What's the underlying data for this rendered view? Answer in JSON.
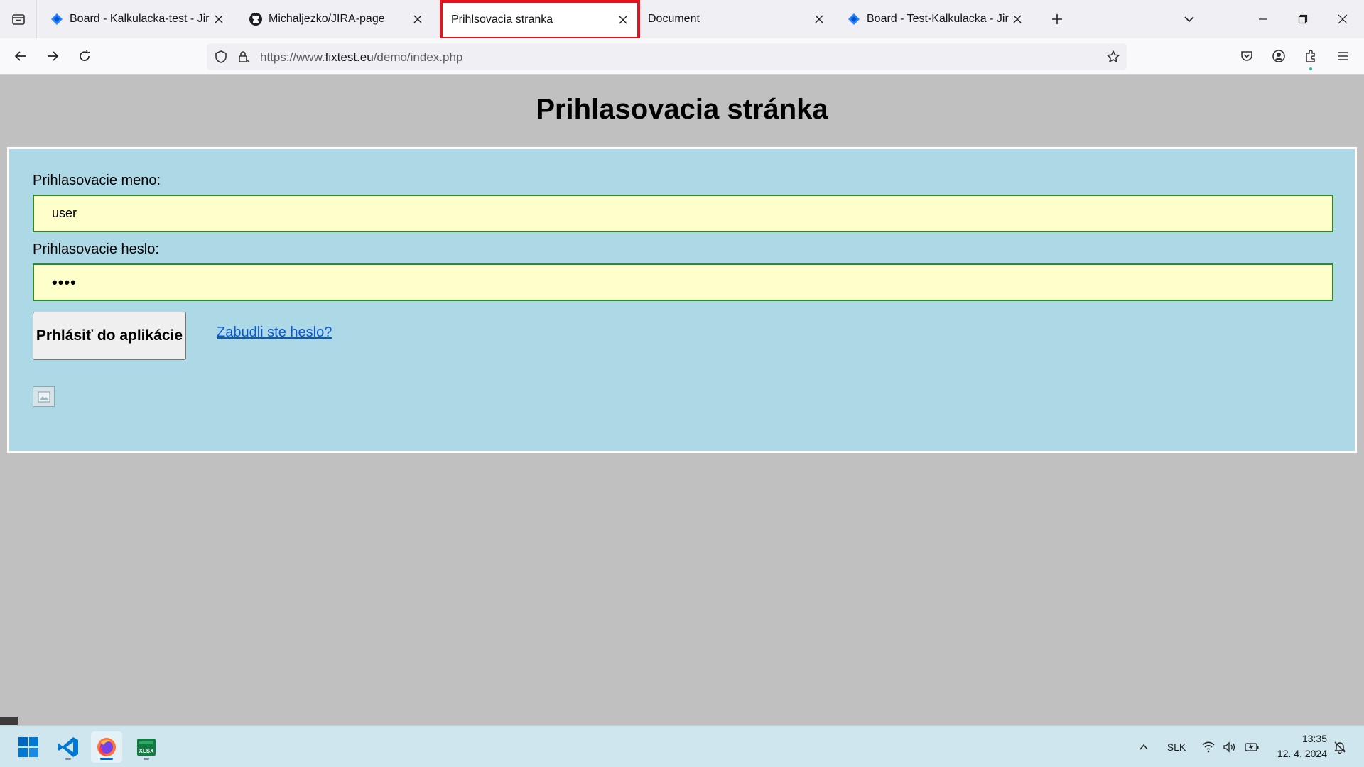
{
  "browser": {
    "tabs": [
      {
        "title": "Board - Kalkulacka-test - Jira",
        "icon": "jira-icon"
      },
      {
        "title": "Michaljezko/JIRA-page",
        "icon": "github-icon"
      },
      {
        "title": "Prihlsovacia stranka",
        "icon": "none",
        "active": true
      },
      {
        "title": "Document",
        "icon": "none"
      },
      {
        "title": "Board - Test-Kalkulacka - Jira",
        "icon": "jira-icon"
      }
    ],
    "url_prefix": "https://www.",
    "url_host": "fixtest.eu",
    "url_path": "/demo/index.php"
  },
  "page": {
    "heading": "Prihlasovacia stránka",
    "username_label": "Prihlasovacie meno:",
    "username_value": "user",
    "password_label": "Prihlasovacie heslo:",
    "password_value": "••••",
    "login_button": "Prhlásiť do aplikácie",
    "forgot_link": "Zabudli ste heslo?"
  },
  "taskbar": {
    "apps": [
      "windows-start",
      "vscode",
      "firefox",
      "excel-xlsx"
    ],
    "language": "SLK",
    "time": "13:35",
    "date": "12. 4. 2024"
  },
  "colors": {
    "accent_tab_border": "#e3141e",
    "panel_bg": "#add8e6",
    "input_bg": "#ffffcc",
    "input_border": "#2d8a2d",
    "page_bg": "#c0c0c0"
  }
}
